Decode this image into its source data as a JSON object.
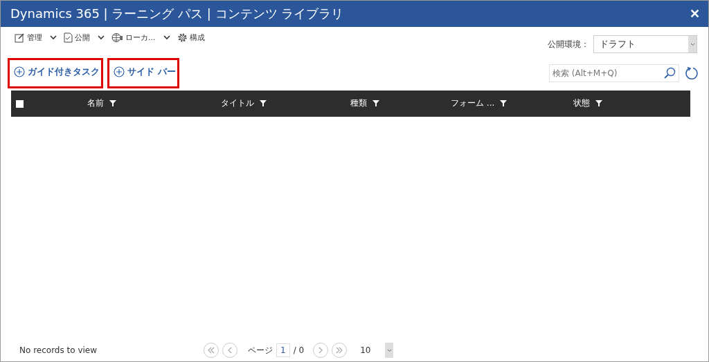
{
  "window": {
    "title": "Dynamics 365 | ラーニング パス | コンテンツ ライブラリ",
    "close": "✕"
  },
  "toolbar": [
    {
      "label": "管理",
      "kind": "edit",
      "dropdown": true
    },
    {
      "label": "公開",
      "kind": "publish",
      "dropdown": true
    },
    {
      "label": "ローカ...",
      "kind": "globe",
      "dropdown": true
    },
    {
      "label": "構成",
      "kind": "gear",
      "dropdown": false
    }
  ],
  "environment": {
    "label": "公開環境：",
    "value": "ドラフト"
  },
  "add_buttons": [
    {
      "label": "ガイド付きタスク",
      "highlighted": true
    },
    {
      "label": "サイド バー",
      "highlighted": true
    }
  ],
  "search": {
    "placeholder": "検索 (Alt+M+Q)"
  },
  "table": {
    "select_all_checked": false,
    "columns": [
      "名前",
      "タイトル",
      "種類",
      "フォーム ...",
      "状態"
    ]
  },
  "footer": {
    "status": "No records to view",
    "page_label": "ページ",
    "page": "1",
    "page_total": "/ 0",
    "page_size": "10"
  }
}
